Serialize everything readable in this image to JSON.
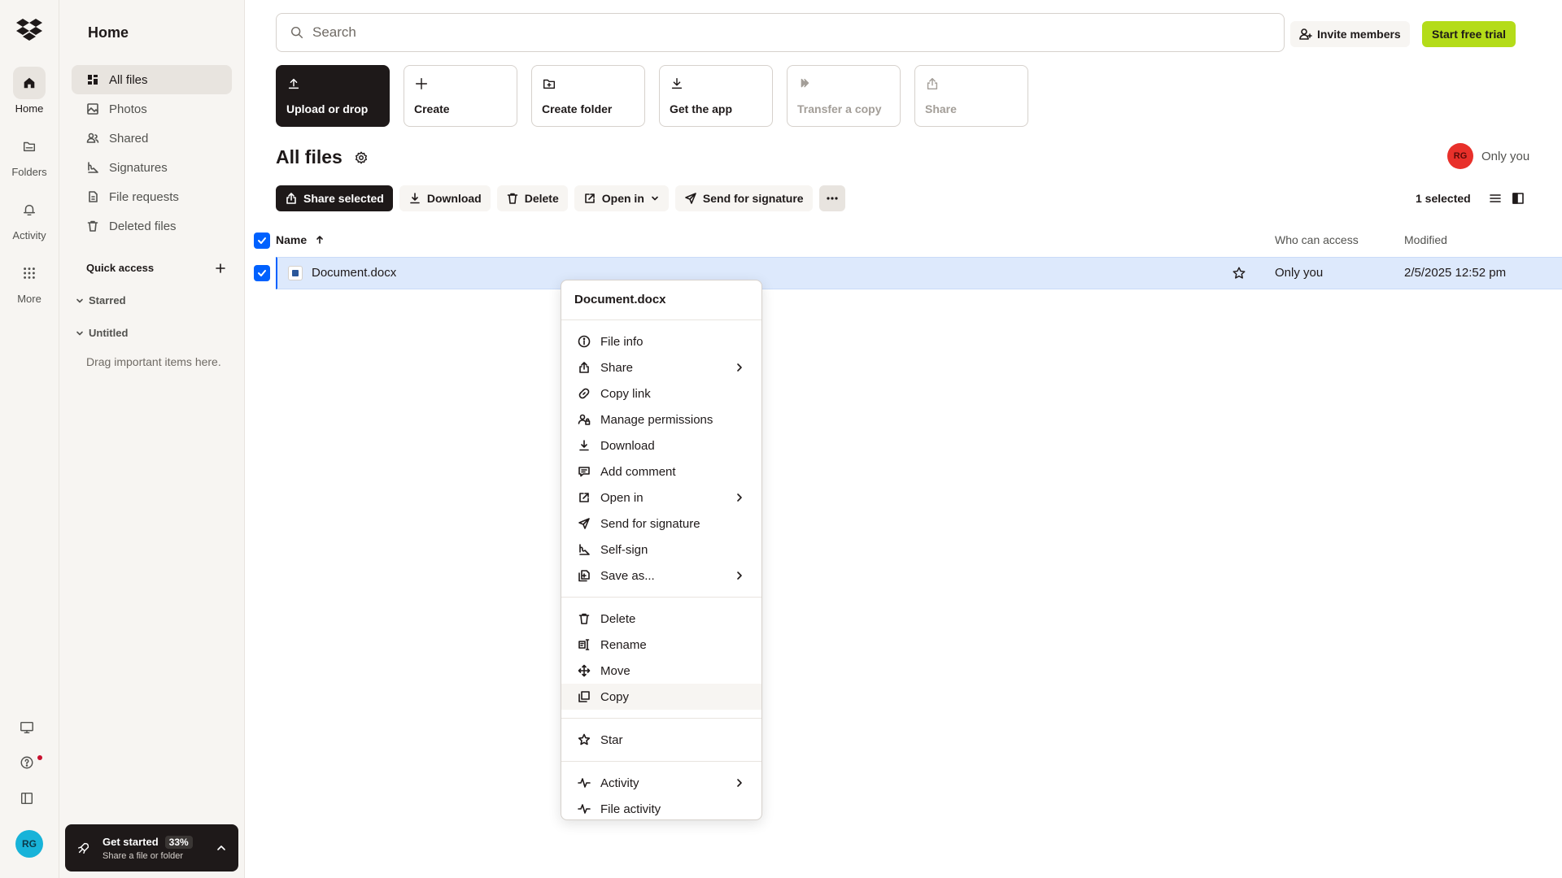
{
  "rail": {
    "items": [
      {
        "label": "Home",
        "icon": "home-icon"
      },
      {
        "label": "Folders",
        "icon": "folder-icon"
      },
      {
        "label": "Activity",
        "icon": "bell-icon"
      },
      {
        "label": "More",
        "icon": "grid-icon"
      }
    ],
    "avatar_initials": "RG"
  },
  "sidebar": {
    "title": "Home",
    "items": [
      {
        "label": "All files",
        "icon": "files-icon"
      },
      {
        "label": "Photos",
        "icon": "photo-icon"
      },
      {
        "label": "Shared",
        "icon": "shared-icon"
      },
      {
        "label": "Signatures",
        "icon": "signature-icon"
      },
      {
        "label": "File requests",
        "icon": "file-request-icon"
      },
      {
        "label": "Deleted files",
        "icon": "trash-icon"
      }
    ],
    "quick_access": {
      "title": "Quick access",
      "starred": "Starred",
      "untitled": "Untitled",
      "empty_text": "Drag important items here."
    },
    "get_started": {
      "title": "Get started",
      "progress": "33%",
      "subtitle": "Share a file or folder"
    }
  },
  "header": {
    "search_placeholder": "Search",
    "invite_label": "Invite members",
    "trial_label": "Start free trial"
  },
  "actions": [
    {
      "label": "Upload or drop",
      "icon": "upload-icon"
    },
    {
      "label": "Create",
      "icon": "plus-icon"
    },
    {
      "label": "Create folder",
      "icon": "folder-plus-icon"
    },
    {
      "label": "Get the app",
      "icon": "download-icon"
    },
    {
      "label": "Transfer a copy",
      "icon": "transfer-icon"
    },
    {
      "label": "Share",
      "icon": "share-icon"
    }
  ],
  "page": {
    "title": "All files",
    "owner_initials": "RG",
    "owner_label": "Only you"
  },
  "toolbar": {
    "share_selected": "Share selected",
    "download": "Download",
    "delete": "Delete",
    "open_in": "Open in",
    "send_for_signature": "Send for signature",
    "selected_count": "1 selected"
  },
  "table": {
    "columns": {
      "name": "Name",
      "access": "Who can access",
      "modified": "Modified"
    },
    "rows": [
      {
        "name": "Document.docx",
        "access": "Only you",
        "modified": "2/5/2025 12:52 pm"
      }
    ]
  },
  "context_menu": {
    "title": "Document.docx",
    "groups": [
      [
        {
          "label": "File info",
          "icon": "info-icon",
          "submenu": false
        },
        {
          "label": "Share",
          "icon": "share-icon",
          "submenu": true
        },
        {
          "label": "Copy link",
          "icon": "link-icon",
          "submenu": false
        },
        {
          "label": "Manage permissions",
          "icon": "permissions-icon",
          "submenu": false
        },
        {
          "label": "Download",
          "icon": "download-icon",
          "submenu": false
        },
        {
          "label": "Add comment",
          "icon": "comment-icon",
          "submenu": false
        },
        {
          "label": "Open in",
          "icon": "open-external-icon",
          "submenu": true
        },
        {
          "label": "Send for signature",
          "icon": "send-icon",
          "submenu": false
        },
        {
          "label": "Self-sign",
          "icon": "signature-icon",
          "submenu": false
        },
        {
          "label": "Save as...",
          "icon": "save-as-icon",
          "submenu": true
        }
      ],
      [
        {
          "label": "Delete",
          "icon": "trash-icon",
          "submenu": false
        },
        {
          "label": "Rename",
          "icon": "rename-icon",
          "submenu": false
        },
        {
          "label": "Move",
          "icon": "move-icon",
          "submenu": false
        },
        {
          "label": "Copy",
          "icon": "copy-icon",
          "submenu": false
        }
      ],
      [
        {
          "label": "Star",
          "icon": "star-icon",
          "submenu": false
        }
      ],
      [
        {
          "label": "Activity",
          "icon": "activity-icon",
          "submenu": true
        },
        {
          "label": "File activity",
          "icon": "activity-icon",
          "submenu": false
        }
      ]
    ]
  },
  "colors": {
    "accent_blue": "#0061fe",
    "trial_green": "#b4dc19",
    "selected_row": "#dde9fc",
    "sidebar_bg": "#f7f5f2"
  }
}
